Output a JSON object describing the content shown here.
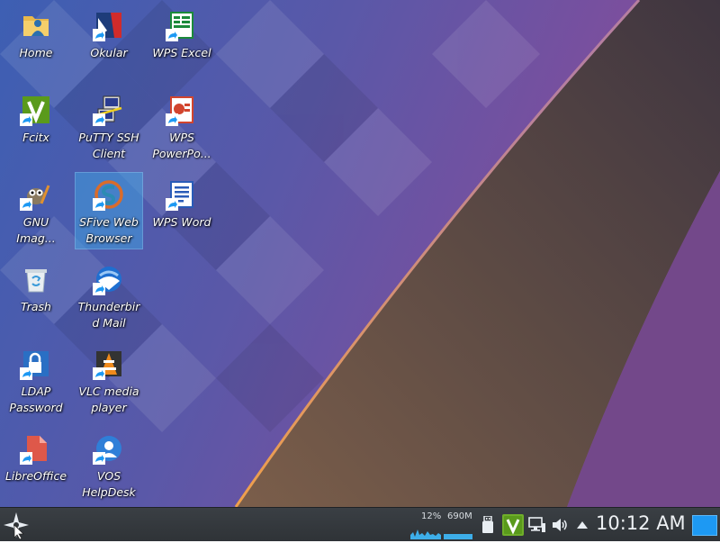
{
  "desktop": {
    "icons": [
      {
        "label": "Home",
        "icon": "folder-home-icon"
      },
      {
        "label": "Okular",
        "icon": "okular-icon"
      },
      {
        "label": "WPS Excel",
        "icon": "wps-excel-icon"
      },
      {
        "label": "Fcitx",
        "icon": "fcitx-icon"
      },
      {
        "label": "PuTTY SSH Client",
        "icon": "putty-icon"
      },
      {
        "label": "WPS PowerPo...",
        "icon": "wps-powerpoint-icon"
      },
      {
        "label": "GNU Imag...",
        "icon": "gimp-icon"
      },
      {
        "label": "SFive Web Browser",
        "icon": "sfive-browser-icon",
        "selected": true
      },
      {
        "label": "WPS Word",
        "icon": "wps-word-icon"
      },
      {
        "label": "Trash",
        "icon": "trash-icon"
      },
      {
        "label": "Thunderbird Mail",
        "icon": "thunderbird-icon"
      },
      {
        "label": "LDAP Password",
        "icon": "ldap-password-icon"
      },
      {
        "label": "VLC media player",
        "icon": "vlc-icon"
      },
      {
        "label": "LibreOffice",
        "icon": "libreoffice-icon"
      },
      {
        "label": "VOS HelpDesk",
        "icon": "helpdesk-icon"
      }
    ]
  },
  "taskbar": {
    "start_icon": "kde-launcher-icon",
    "system_monitor": {
      "cpu": "12%",
      "memory": "690M"
    },
    "tray": [
      "usb-icon",
      "fcitx-icon",
      "network-icon",
      "volume-icon",
      "expand-arrow-icon"
    ],
    "clock": "10:12 AM",
    "accent_color": "#1d99f3"
  }
}
